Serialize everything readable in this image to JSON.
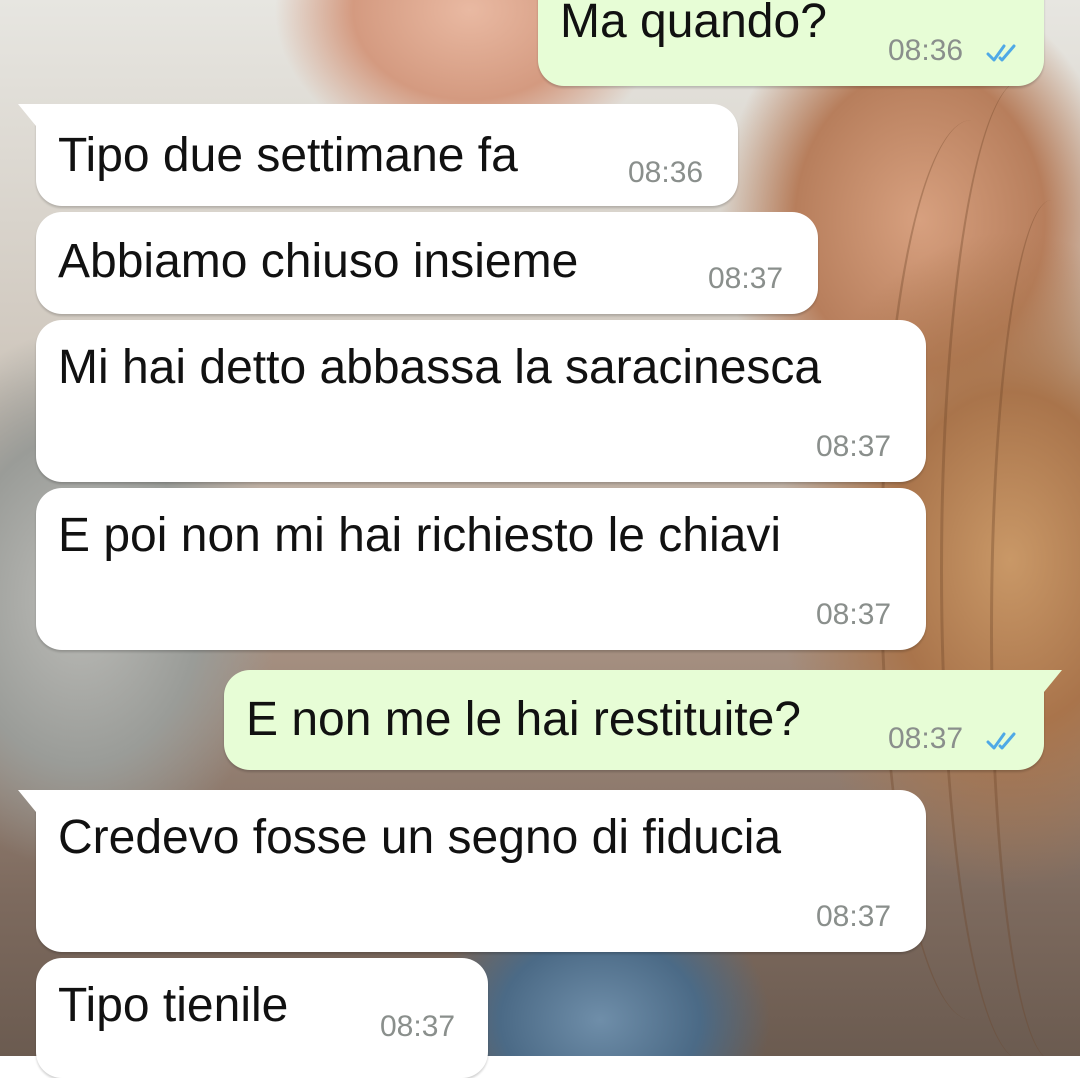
{
  "colors": {
    "incoming_bubble": "#ffffff",
    "outgoing_bubble": "#e7fdd6",
    "timestamp": "#8a8f8c",
    "read_ticks": "#4fa9e6"
  },
  "messages": [
    {
      "direction": "outgoing",
      "text": "Ma quando?",
      "time": "08:36",
      "status": "read-double-check-icon"
    },
    {
      "direction": "incoming",
      "text": "Tipo due settimane fa",
      "time": "08:36"
    },
    {
      "direction": "incoming",
      "text": "Abbiamo chiuso insieme",
      "time": "08:37"
    },
    {
      "direction": "incoming",
      "text": "Mi hai detto abbassa la saracinesca",
      "time": "08:37"
    },
    {
      "direction": "incoming",
      "text": "E poi non mi hai richiesto le chiavi",
      "time": "08:37"
    },
    {
      "direction": "outgoing",
      "text": "E non me le hai restituite?",
      "time": "08:37",
      "status": "read-double-check-icon"
    },
    {
      "direction": "incoming",
      "text": "Credevo fosse un segno di fiducia",
      "time": "08:37"
    },
    {
      "direction": "incoming",
      "text": "Tipo tienile",
      "time": "08:37"
    }
  ]
}
